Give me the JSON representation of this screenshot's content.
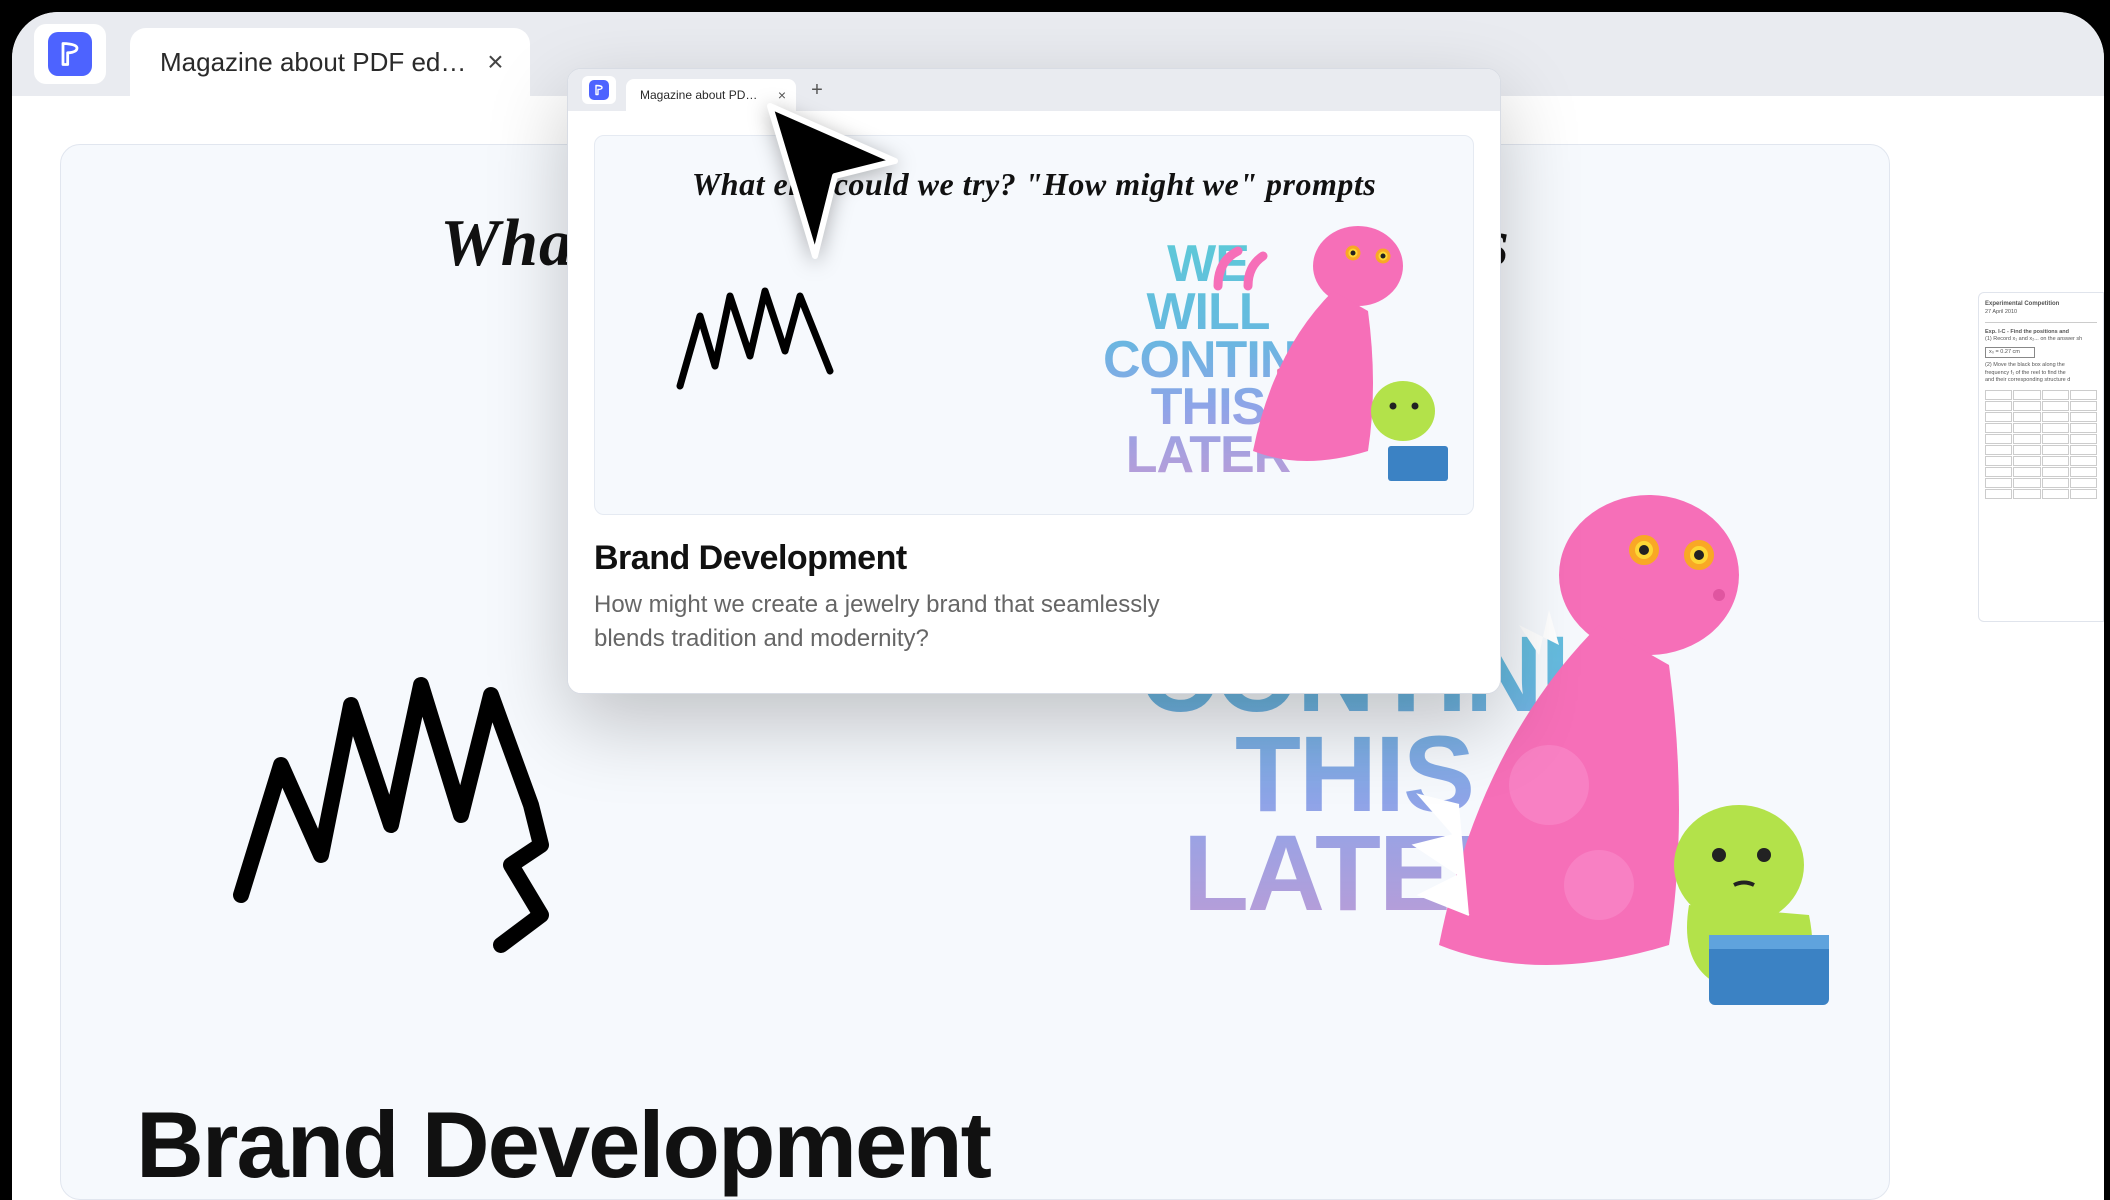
{
  "tab": {
    "title": "Magazine about PDF ed…"
  },
  "preview": {
    "tab_title": "Magazine about PD…",
    "heading": "What else could we try? \"How might we\" prompts",
    "title": "Brand Development",
    "subtitle": "How might we create a jewelry brand that seamlessly blends tradition and modernity?",
    "sticker_line1": "WE WILL",
    "sticker_line2": "CONTINUE",
    "sticker_line3": "THIS",
    "sticker_line4": "LATER"
  },
  "main": {
    "heading_left": "What e",
    "heading_right": "prompts",
    "title": "Brand Development",
    "sticker_line2": "CONTINUE",
    "sticker_line3": "THIS",
    "sticker_line4": "LATER"
  },
  "thumbnail": {
    "title": "Experimental Competition",
    "date": "27 April 2010",
    "exp": "Exp. I-C - Find the positions and",
    "sub1": "(1) Record x₁ and x₂... on the answer sh",
    "box": "x₀ = 0.27 cm",
    "sub2": "(2) Move the black box along the",
    "sub3": "frequency f₁ of the reel to find the",
    "sub4": "and their corresponding structure d"
  }
}
